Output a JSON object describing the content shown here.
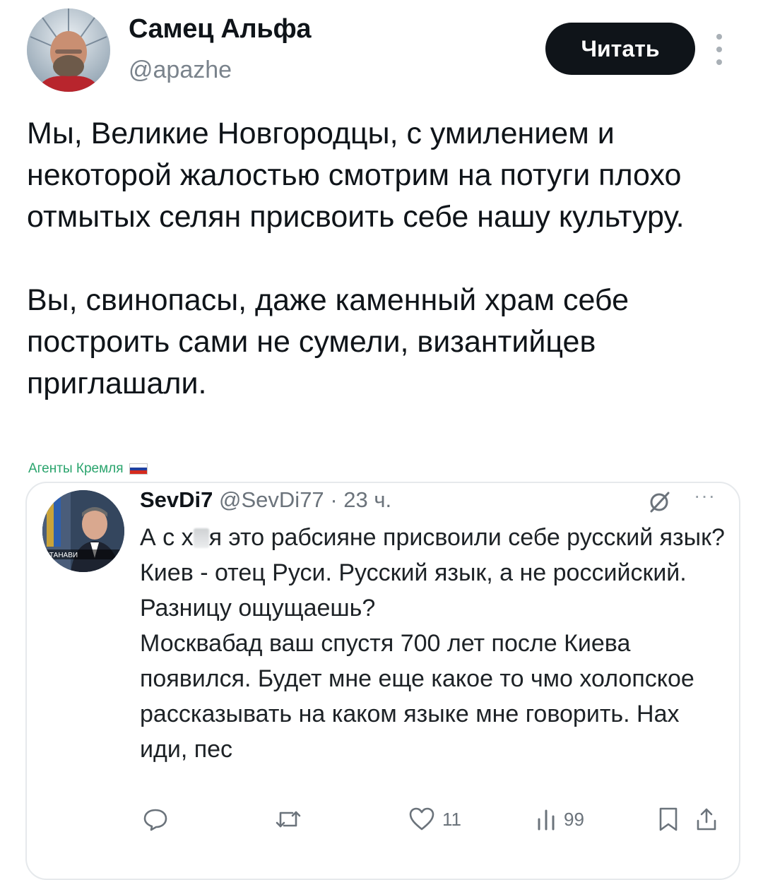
{
  "author": {
    "display_name": "Самец Альфа",
    "handle": "@apazhe",
    "avatar": "avatar-photo"
  },
  "follow_button": {
    "label": "Читать"
  },
  "more_menu": {
    "icon": "more-vertical-icon"
  },
  "tweet": {
    "paragraphs": [
      "Мы, Великие Новгородцы, с умилением и некоторой жалостью смотрим на потуги плохо отмытых селян присвоить себе нашу культуру.",
      "Вы, свинопасы, даже каменный храм себе построить сами не сумели, византийцев приглашали."
    ]
  },
  "watermark": {
    "text": "Агенты Кремля",
    "flag_colors": [
      "#ffffff",
      "#1f3f9f",
      "#d52b1e"
    ]
  },
  "quoted": {
    "display_name": "SevDi7",
    "handle": "@SevDi77",
    "separator": "·",
    "time": "23 ч.",
    "avatar_caption": "СТАНАВИ",
    "text_prefix": "А с х",
    "text_rest": "я это рабсияне присвоили себе русский язык? Киев - отец Руси. Русский язык, а не российский. Разницу ощущаешь?",
    "text_second": "Москвабад ваш спустя 700 лет после Киева появился. Будет мне еще какое то чмо холопское рассказывать на каком языке мне говорить. Нах иди, пес",
    "more": "···",
    "actions": {
      "reply_icon": "reply-icon",
      "retweet_icon": "retweet-icon",
      "like_icon": "heart-icon",
      "like_count": "11",
      "views_icon": "views-icon",
      "views_count": "99",
      "bookmark_icon": "bookmark-icon",
      "share_icon": "share-icon"
    }
  }
}
